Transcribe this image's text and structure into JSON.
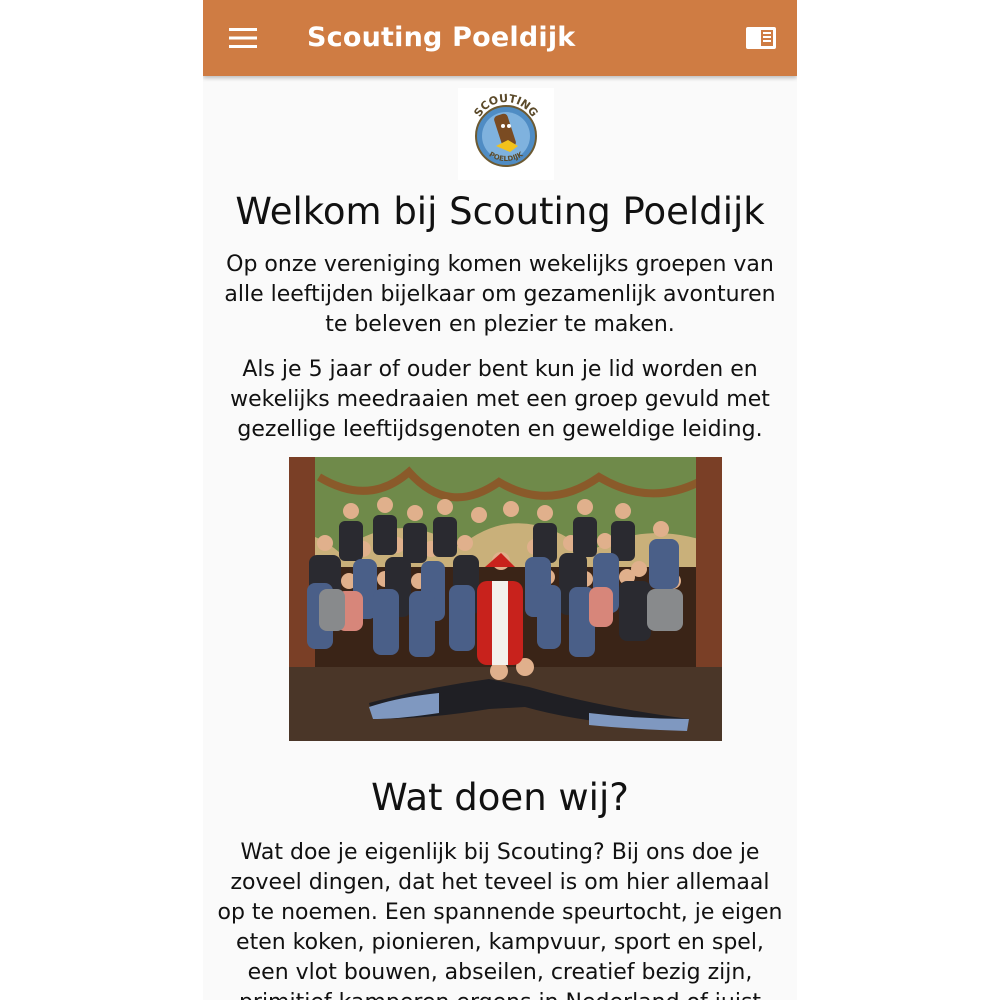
{
  "appbar": {
    "title": "Scouting Poeldijk",
    "menu_icon": "hamburger-menu-icon",
    "right_icon": "book-icon",
    "color": "#cf7c43"
  },
  "logo": {
    "text_top": "SCOUTING",
    "text_bottom": "POELDIJK"
  },
  "welcome": {
    "heading": "Welkom bij Scouting Poeldijk",
    "paragraph_1": "Op onze vereniging komen wekelijks groepen van alle leeftijden bijelkaar om gezamenlijk avonturen te beleven en plezier te maken.",
    "paragraph_2": "Als je 5 jaar of ouder bent kun je lid worden en wekelijks meedraaien met een groep gevuld met gezellige leeftijdsgenoten en geweldige leiding."
  },
  "what_we_do": {
    "heading": "Wat doen wij?",
    "paragraph": "Wat doe je eigenlijk bij Scouting? Bij ons doe je zoveel dingen, dat het teveel is om hier allemaal op te noemen. Een spannende speurtocht, je eigen eten koken, pionieren, kampvuur, sport en spel, een vlot bouwen, abseilen, creatief bezig zijn, primitief kamperen ergens in Nederland of juist"
  }
}
